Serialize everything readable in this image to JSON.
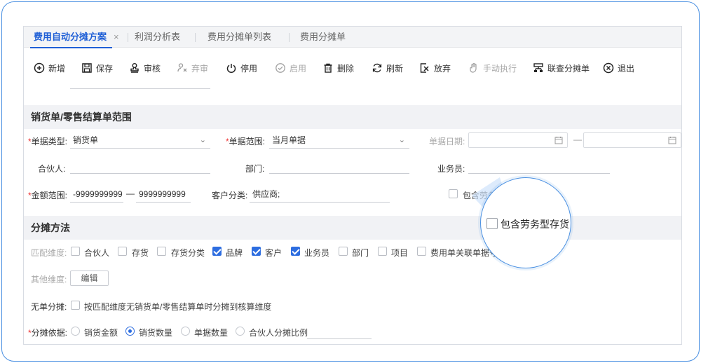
{
  "tabs": [
    {
      "label": "费用自动分摊方案",
      "active": true,
      "close": "×"
    },
    {
      "label": "利润分析表"
    },
    {
      "label": "费用分摊单列表"
    },
    {
      "label": "费用分摊单"
    }
  ],
  "toolbar": {
    "add": "新增",
    "save": "保存",
    "audit": "审核",
    "unaudit": "弃审",
    "disable": "停用",
    "enable": "启用",
    "delete": "删除",
    "refresh": "刷新",
    "abandon": "放弃",
    "manual_run": "手动执行",
    "query_alloc": "联查分摊单",
    "exit": "退出"
  },
  "section_sales": {
    "title": "销货单/零售结算单范围",
    "doc_type_label": "单据类型:",
    "doc_type_value": "销货单",
    "doc_range_label": "单据范围:",
    "doc_range_value": "当月单据",
    "doc_date_label": "单据日期:",
    "date_dash": "—",
    "partner_label": "合伙人:",
    "dept_label": "部门:",
    "salesman_label": "业务员:",
    "amount_label": "金额范围:",
    "amount_from": "-9999999999",
    "amount_dash": "—",
    "amount_to": "9999999999",
    "customer_class_label": "客户分类:",
    "customer_class_value": "供应商;",
    "include_service_label": "包含劳务型存货"
  },
  "section_alloc": {
    "title": "分摊方法",
    "match_label": "匹配维度:",
    "match_options": [
      {
        "label": "合伙人",
        "checked": false
      },
      {
        "label": "存货",
        "checked": false
      },
      {
        "label": "存货分类",
        "checked": false
      },
      {
        "label": "品牌",
        "checked": true
      },
      {
        "label": "客户",
        "checked": true
      },
      {
        "label": "业务员",
        "checked": true
      },
      {
        "label": "部门",
        "checked": false
      },
      {
        "label": "项目",
        "checked": false
      },
      {
        "label": "费用单关联单据号",
        "checked": false
      }
    ],
    "other_label": "其他维度:",
    "edit_button": "编辑",
    "no_doc_label": "无单分摊:",
    "no_doc_option": "按匹配维度无销货单/零售结算单时分摊到核算维度",
    "basis_label": "分摊依据:",
    "basis_options": [
      {
        "label": "销货金额",
        "checked": false
      },
      {
        "label": "销货数量",
        "checked": true
      },
      {
        "label": "单据数量",
        "checked": false
      },
      {
        "label": "合伙人分摊比例",
        "checked": false
      }
    ]
  },
  "magnifier": {
    "label": "包含劳务型存货"
  },
  "colors": {
    "accent": "#1f5fd6",
    "frame": "#4a90e2",
    "checked": "#2d6de0",
    "required": "#e33333"
  }
}
